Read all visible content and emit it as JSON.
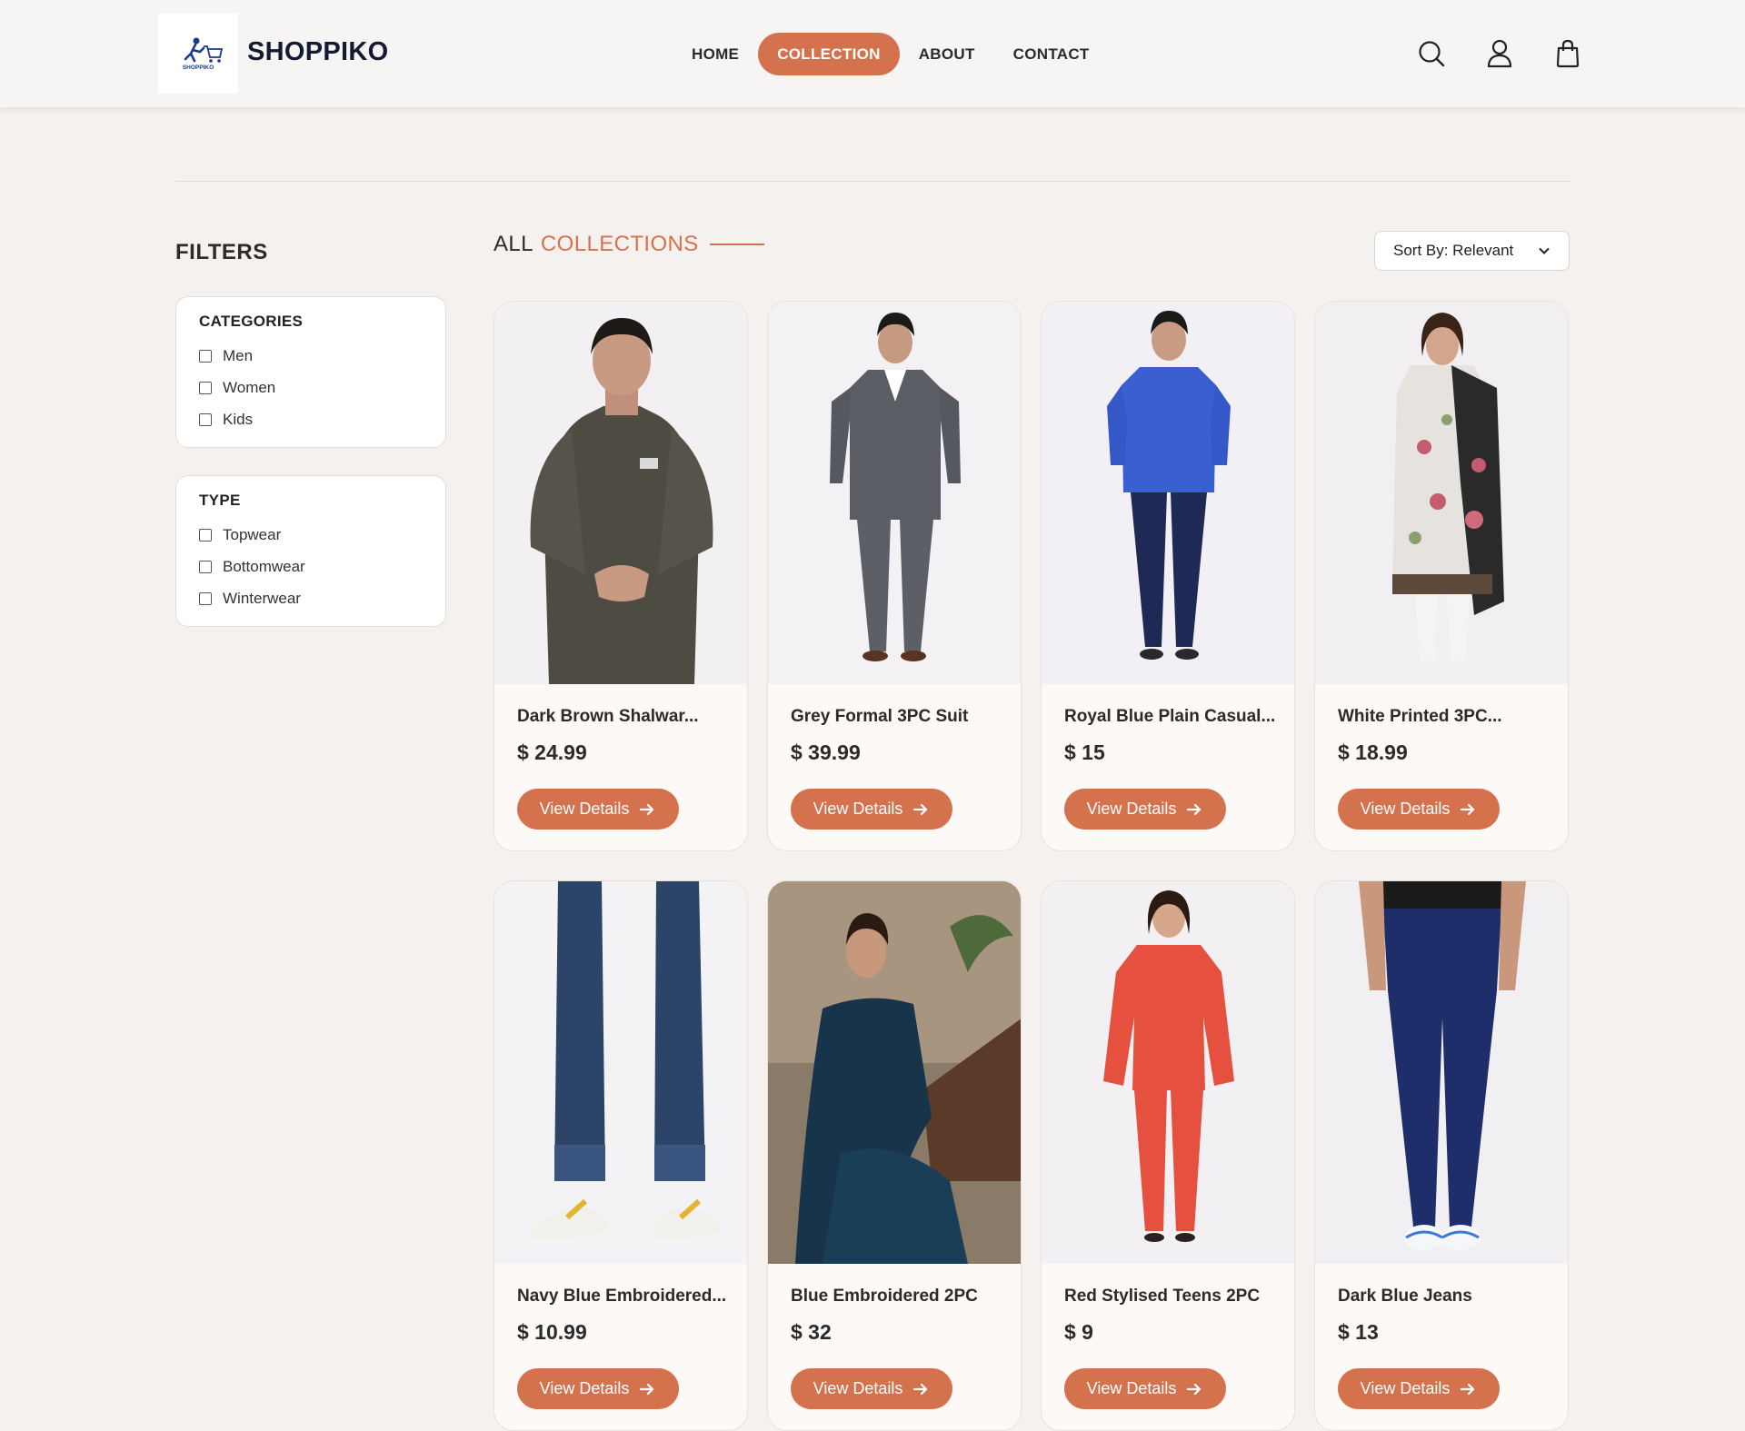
{
  "brand": {
    "name": "SHOPPIKO",
    "logo_text": "SHOPPIKO"
  },
  "nav": [
    {
      "label": "HOME",
      "active": false
    },
    {
      "label": "COLLECTION",
      "active": true
    },
    {
      "label": "ABOUT",
      "active": false
    },
    {
      "label": "CONTACT",
      "active": false
    }
  ],
  "header_icons": [
    "search-icon",
    "user-icon",
    "shopping-bag-icon"
  ],
  "filters": {
    "title": "FILTERS",
    "categories": {
      "title": "CATEGORIES",
      "options": [
        "Men",
        "Women",
        "Kids"
      ]
    },
    "type": {
      "title": "TYPE",
      "options": [
        "Topwear",
        "Bottomwear",
        "Winterwear"
      ]
    }
  },
  "collection": {
    "title_part1": "ALL",
    "title_part2": "COLLECTIONS",
    "sort_label": "Sort By: Relevant"
  },
  "products": [
    {
      "name": "Dark Brown Shalwar...",
      "price": "$ 24.99",
      "button": "View Details"
    },
    {
      "name": "Grey Formal 3PC Suit",
      "price": "$ 39.99",
      "button": "View Details"
    },
    {
      "name": "Royal Blue Plain Casual...",
      "price": "$ 15",
      "button": "View Details"
    },
    {
      "name": "White Printed 3PC...",
      "price": "$ 18.99",
      "button": "View Details"
    },
    {
      "name": "Navy Blue Embroidered...",
      "price": "$ 10.99",
      "button": "View Details"
    },
    {
      "name": "Blue Embroidered 2PC",
      "price": "$ 32",
      "button": "View Details"
    },
    {
      "name": "Red Stylised Teens 2PC",
      "price": "$ 9",
      "button": "View Details"
    },
    {
      "name": "Dark Blue Jeans",
      "price": "$ 13",
      "button": "View Details"
    }
  ],
  "colors": {
    "accent": "#d5724e",
    "background": "#f5f1ee",
    "brand_text": "#131a33"
  }
}
